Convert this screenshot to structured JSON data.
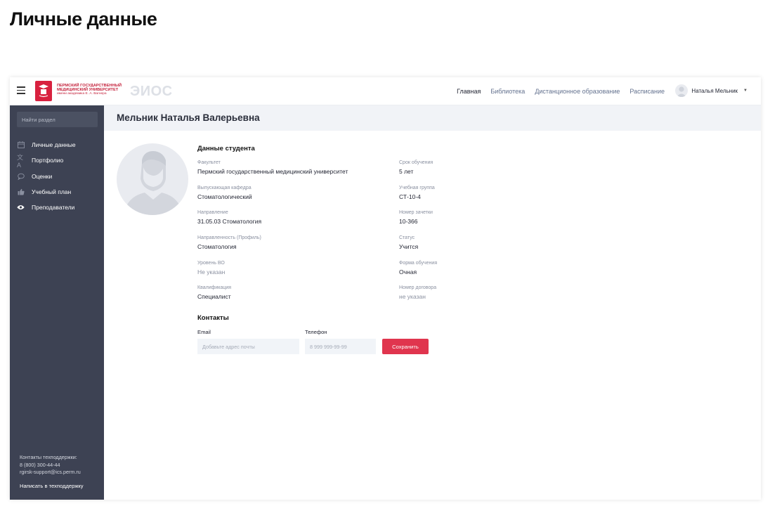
{
  "page_heading": "Личные данные",
  "topbar": {
    "university": {
      "line1": "ПЕРМСКИЙ ГОСУДАРСТВЕННЫЙ",
      "line2": "МЕДИЦИНСКИЙ УНИВЕРСИТЕТ",
      "line3": "имени академика Е. А. Вагнера"
    },
    "app_name": "ЭИОС",
    "nav": [
      {
        "label": "Главная",
        "active": true
      },
      {
        "label": "Библиотека",
        "active": false
      },
      {
        "label": "Дистанционное образование",
        "active": false
      },
      {
        "label": "Расписание",
        "active": false
      }
    ],
    "user_name": "Наталья Мельник"
  },
  "sidebar": {
    "search_placeholder": "Найти раздел",
    "items": [
      {
        "label": "Личные данные",
        "icon": "calendar-icon"
      },
      {
        "label": "Портфолио",
        "icon": "translate-icon"
      },
      {
        "label": "Оценки",
        "icon": "chat-bubble-icon"
      },
      {
        "label": "Учебный план",
        "icon": "thumbs-up-icon"
      },
      {
        "label": "Преподаватели",
        "icon": "eye-icon"
      }
    ],
    "support": {
      "title": "Контакты техподдержки:",
      "phone": "8 (800) 300-44-44",
      "email": "rgirsk-support@ics.perm.ru",
      "write_link": "Написать в техподдержку"
    }
  },
  "main": {
    "full_name": "Мельник Наталья Валерьевна",
    "student_section_title": "Данные студента",
    "fields_left": [
      {
        "label": "Факультет",
        "value": "Пермский государственный медицинский университет",
        "muted": false
      },
      {
        "label": "Выпускающая кафедра",
        "value": "Стоматологический",
        "muted": false
      },
      {
        "label": "Направление",
        "value": "31.05.03 Стоматология",
        "muted": false
      },
      {
        "label": "Направленность (Профиль)",
        "value": "Стоматология",
        "muted": false
      },
      {
        "label": "Уровень ВО",
        "value": "Не указан",
        "muted": true
      },
      {
        "label": "Квалификация",
        "value": "Специалист",
        "muted": false
      }
    ],
    "fields_right": [
      {
        "label": "Срок обучения",
        "value": "5 лет",
        "muted": false
      },
      {
        "label": "Учебная группа",
        "value": "СТ-10-4",
        "muted": false
      },
      {
        "label": "Номер зачетки",
        "value": "10-366",
        "muted": false
      },
      {
        "label": "Статус",
        "value": "Учится",
        "muted": false
      },
      {
        "label": "Форма обучения",
        "value": "Очная",
        "muted": false
      },
      {
        "label": "Номер договора",
        "value": "не указан",
        "muted": true
      }
    ],
    "contacts": {
      "title": "Контакты",
      "email_label": "Email",
      "email_placeholder": "Добавьте адрес почты",
      "phone_label": "Телефон",
      "phone_placeholder": "8 999 999-99-99",
      "save_label": "Сохранить"
    }
  },
  "colors": {
    "sidebar_bg": "#3d4253",
    "accent": "#e0354e",
    "brand_red": "#d8213f",
    "header_band": "#f1f3f7"
  }
}
